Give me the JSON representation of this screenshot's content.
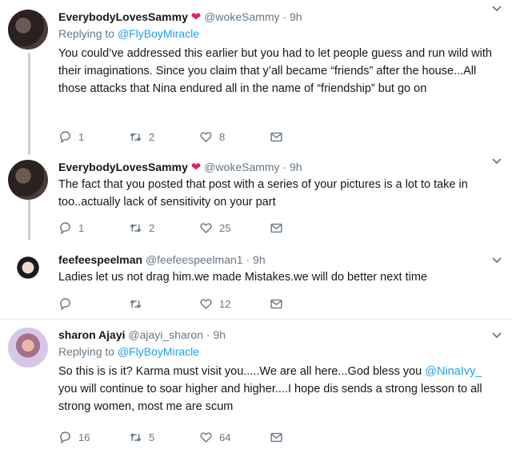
{
  "tweets": [
    {
      "display_name": "EverybodyLovesSammy",
      "heart": "❤",
      "handle": "@wokeSammy",
      "sep": "·",
      "time": "9h",
      "reply_label": "Replying to",
      "reply_to": "@FlyBoyMiracle",
      "text": "You could’ve addressed this earlier but you had to let people guess and run wild with their imaginations. Since you claim that y’all became “friends” after the house...All those attacks that Nina endured all in the name of “friendship” but go on",
      "replies": "1",
      "retweets": "2",
      "likes": "8",
      "reply_icon": "reply-icon",
      "retweet_icon": "retweet-icon",
      "like_icon": "heart-icon",
      "dm_icon": "mail-icon"
    },
    {
      "display_name": "EverybodyLovesSammy",
      "heart": "❤",
      "handle": "@wokeSammy",
      "sep": "·",
      "time": "9h",
      "text": "The fact that you posted that post with a series of your pictures is a lot to take in too..actually lack of sensitivity on your part",
      "replies": "1",
      "retweets": "2",
      "likes": "25"
    },
    {
      "display_name": "feefeespeelman",
      "handle": "@feefeespeelman1",
      "sep": "·",
      "time": "9h",
      "text": "Ladies let us not drag him.we made Mistakes.we will do better next time",
      "replies": "",
      "retweets": "",
      "likes": "12"
    },
    {
      "display_name": "sharon Ajayi",
      "handle": "@ajayi_sharon",
      "sep": "·",
      "time": "9h",
      "reply_label": "Replying to",
      "reply_to": "@FlyBoyMiracle",
      "text_before": "So this is is it? Karma must visit you.....We are all here...God bless you ",
      "mention": "@NinaIvy_",
      "text_after": " you will continue to soar higher and higher....I hope dis sends a strong lesson to all strong women, most me are scum",
      "replies": "16",
      "retweets": "5",
      "likes": "64"
    }
  ],
  "colors": {
    "link": "#1da1f2",
    "meta": "#657786",
    "heart": "#e0245e",
    "thread_line": "#c4cfd6",
    "divider": "#e6ecf0"
  }
}
